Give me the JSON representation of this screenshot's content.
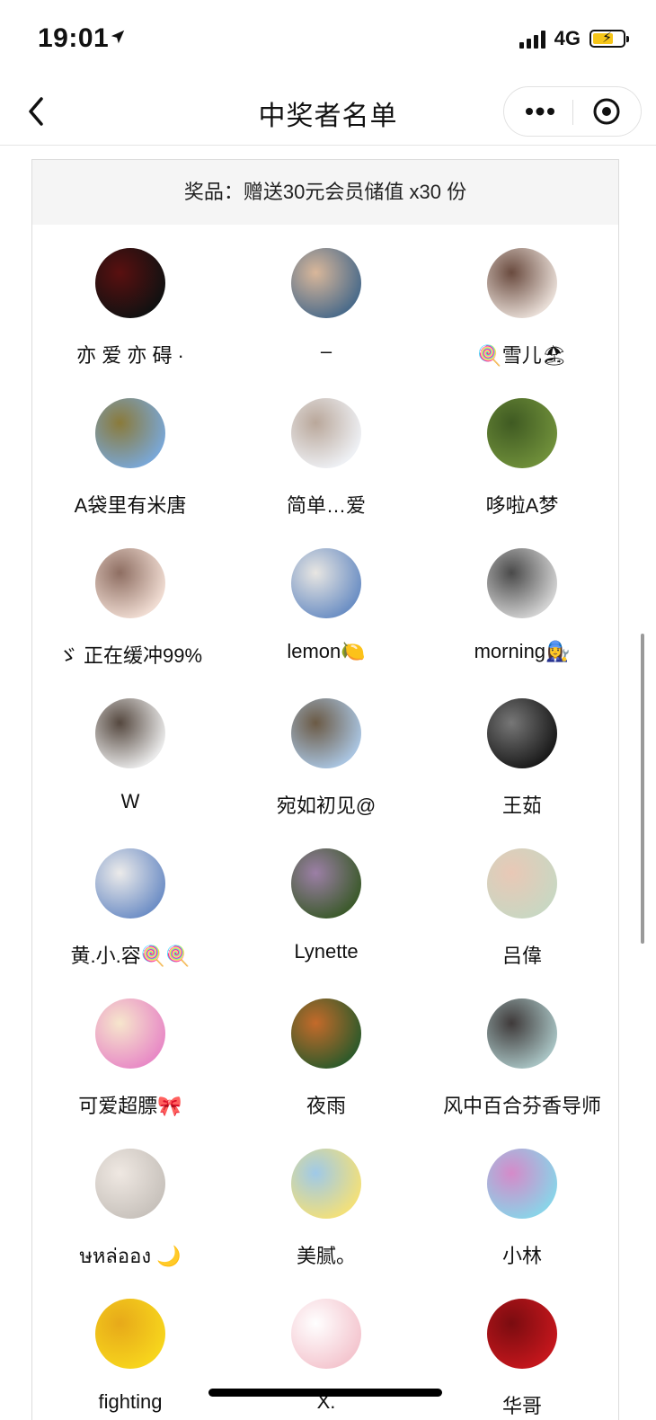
{
  "status_bar": {
    "time": "19:01",
    "network": "4G"
  },
  "nav": {
    "title": "中奖者名单"
  },
  "prize": {
    "text": "奖品：赠送30元会员储值 x30 份"
  },
  "winners": [
    {
      "name": "亦 爱 亦 碍 ·",
      "avatar": [
        "#111111",
        "#5a1010"
      ]
    },
    {
      "name": "–",
      "avatar": [
        "#4b6b8a",
        "#d9b79a"
      ]
    },
    {
      "name": "🍭雪儿🏖",
      "avatar": [
        "#e8ddd6",
        "#6a4b3f"
      ]
    },
    {
      "name": "A袋里有米唐",
      "avatar": [
        "#7aa7d6",
        "#8a7a3a"
      ]
    },
    {
      "name": "简单…爱",
      "avatar": [
        "#eef0f4",
        "#b9a79a"
      ]
    },
    {
      "name": "哆啦A梦",
      "avatar": [
        "#6f8f3a",
        "#3f5a22"
      ]
    },
    {
      "name": "ゞ 正在缓冲99%",
      "avatar": [
        "#f0dcd2",
        "#8e6e62"
      ]
    },
    {
      "name": "lemon🍋",
      "avatar": [
        "#6c8fc4",
        "#e8e6e2"
      ]
    },
    {
      "name": "morning👩‍🔧",
      "avatar": [
        "#d2d2d2",
        "#4a4a4a"
      ]
    },
    {
      "name": "W",
      "avatar": [
        "#eaeaea",
        "#55483f"
      ]
    },
    {
      "name": "宛如初见@",
      "avatar": [
        "#a9c4e0",
        "#6b5a45"
      ]
    },
    {
      "name": "王茹",
      "avatar": [
        "#1a1a1a",
        "#777777"
      ]
    },
    {
      "name": "黄.小.容🍭🍭",
      "avatar": [
        "#6f8fc6",
        "#ecebea"
      ]
    },
    {
      "name": "Lynette",
      "avatar": [
        "#3c5a2c",
        "#9c7fa6"
      ]
    },
    {
      "name": "吕偉",
      "avatar": [
        "#c9d7c2",
        "#e9c8b6"
      ]
    },
    {
      "name": "可爱超膘🎀",
      "avatar": [
        "#e88ac6",
        "#f6e6cc"
      ]
    },
    {
      "name": "夜雨",
      "avatar": [
        "#2f5a2a",
        "#c46a2a"
      ]
    },
    {
      "name": "风中百合芬香导师",
      "avatar": [
        "#a7c2c2",
        "#3f3a3a"
      ]
    },
    {
      "name": "ษหล่ออง 🌙",
      "avatar": [
        "#c8c2bc",
        "#efe8e2"
      ]
    },
    {
      "name": "美腻。",
      "avatar": [
        "#f2e07a",
        "#9fc9e8"
      ]
    },
    {
      "name": "小林",
      "avatar": [
        "#8ad3e8",
        "#d58ac9"
      ]
    },
    {
      "name": "fighting",
      "avatar": [
        "#f7d51c",
        "#e7a91a"
      ]
    },
    {
      "name": "X.",
      "avatar": [
        "#f4c6cf",
        "#ffffff"
      ]
    },
    {
      "name": "华哥",
      "avatar": [
        "#c4161c",
        "#7a0c10"
      ]
    }
  ]
}
